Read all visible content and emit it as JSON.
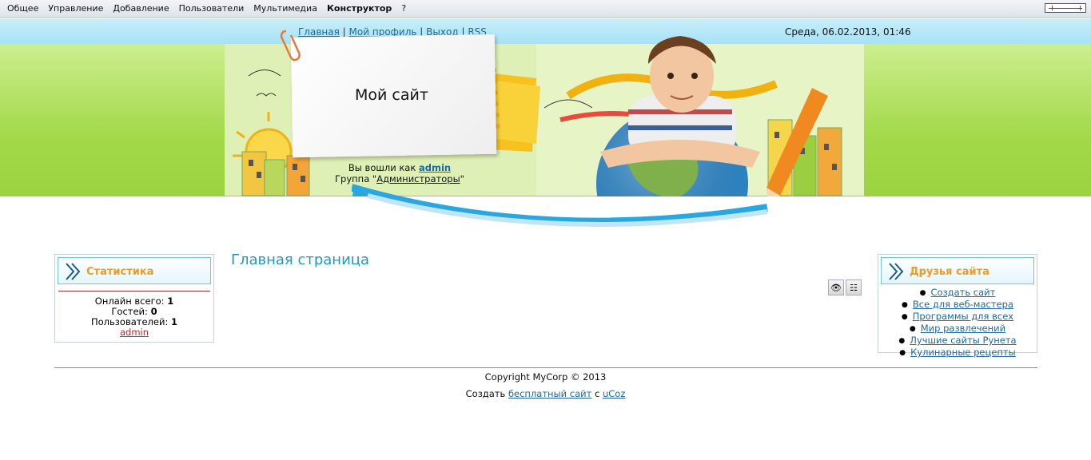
{
  "adminbar": {
    "items": [
      "Общее",
      "Управление",
      "Добавление",
      "Пользователи",
      "Мультимедиа",
      "Конструктор",
      "?"
    ],
    "active": "Конструктор"
  },
  "header": {
    "links": [
      "Главная",
      "Мой профиль",
      "Выход",
      "RSS"
    ],
    "separator": "|",
    "datetime": "Среда, 06.02.2013, 01:46",
    "site_name": "Мой сайт",
    "logged_prefix": "Вы вошли как",
    "username": "admin",
    "group_prefix": "Группа \"",
    "group_name": "Администраторы",
    "group_suffix": "\""
  },
  "stats": {
    "title": "Статистика",
    "online_label": "Онлайн всего:",
    "online_value": "1",
    "guests_label": "Гостей:",
    "guests_value": "0",
    "users_label": "Пользователей:",
    "users_value": "1",
    "user_link": "admin"
  },
  "main": {
    "title": "Главная страница"
  },
  "friends": {
    "title": "Друзья сайта",
    "links": [
      "Создать сайт",
      "Все для веб-мастера",
      "Программы для всех",
      "Мир развлечений",
      "Лучшие сайты Рунета",
      "Кулинарные рецепты"
    ]
  },
  "footer": {
    "copyright": "Copyright MyCorp © 2013",
    "create_prefix": "Создать",
    "free_site": "бесплатный сайт",
    "with": "с",
    "ucoz": "uCoz"
  },
  "colors": {
    "block_title": "#f39a1f",
    "page_title": "#1b9bc6",
    "link": "#1c6aa3",
    "header_green": "#a3d94a"
  }
}
